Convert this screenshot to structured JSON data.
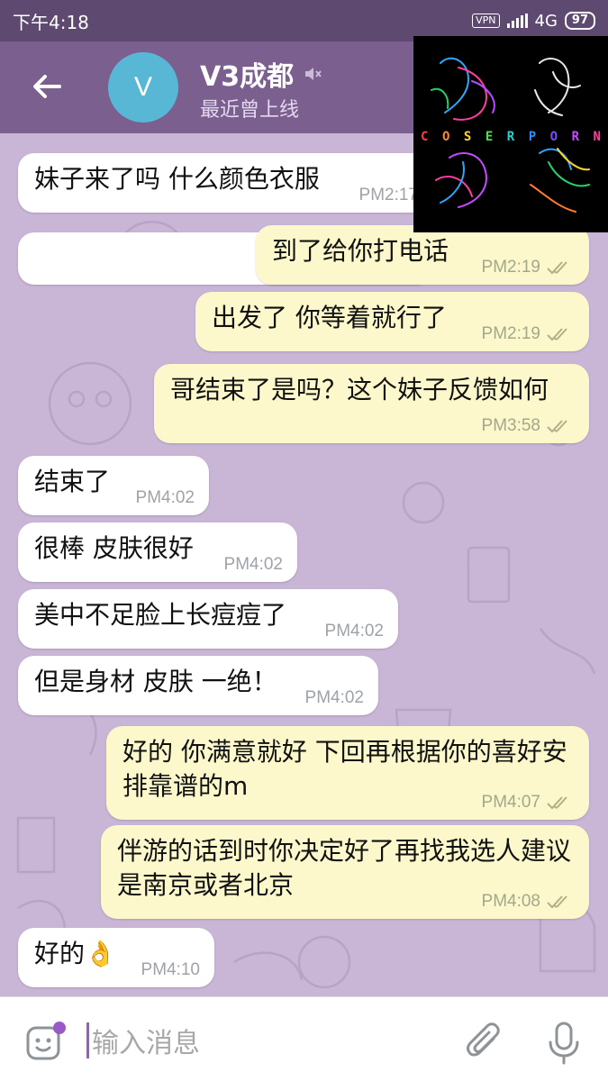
{
  "status_bar": {
    "time": "下午4:18",
    "vpn": "VPN",
    "network": "4G",
    "battery": "97"
  },
  "header": {
    "avatar_letter": "V",
    "title": "V3成都",
    "status": "最近曾上线",
    "muted_icon": "mute-speaker-icon",
    "back_icon": "back-arrow-icon"
  },
  "overlay": {
    "letters": [
      "C",
      "O",
      "S",
      "E",
      "R",
      "P",
      "O",
      "R",
      "N"
    ]
  },
  "messages": [
    {
      "dir": "in",
      "text": "妹子来了吗 什么颜色衣服",
      "time": "PM2:17"
    },
    {
      "dir": "out",
      "text": "到了给你打电话",
      "time": "PM2:19"
    },
    {
      "dir": "out",
      "text": "出发了 你等着就行了",
      "time": "PM2:19"
    },
    {
      "dir": "out",
      "text": "哥结束了是吗？这个妹子反馈如何",
      "time": "PM3:58"
    },
    {
      "dir": "in",
      "text": "结束了",
      "time": "PM4:02"
    },
    {
      "dir": "in",
      "text": "很棒 皮肤很好",
      "time": "PM4:02"
    },
    {
      "dir": "in",
      "text": "美中不足脸上长痘痘了",
      "time": "PM4:02"
    },
    {
      "dir": "in",
      "text": "但是身材 皮肤 一绝！",
      "time": "PM4:02"
    },
    {
      "dir": "out",
      "text": "好的  你满意就好 下回再根据你的喜好安排靠谱的m",
      "time": "PM4:07"
    },
    {
      "dir": "out",
      "text": "伴游的话到时你决定好了再找我选人建议是南京或者北京",
      "time": "PM4:08"
    },
    {
      "dir": "in",
      "text": "好的👌",
      "time": "PM4:10"
    }
  ],
  "input": {
    "placeholder": "输入消息"
  },
  "colors": {
    "header": "#7a5f8f",
    "status_bar": "#5e4a70",
    "chat_bg": "#c9b5d6",
    "outgoing_bubble": "#fdf8cc",
    "incoming_bubble": "#ffffff"
  }
}
